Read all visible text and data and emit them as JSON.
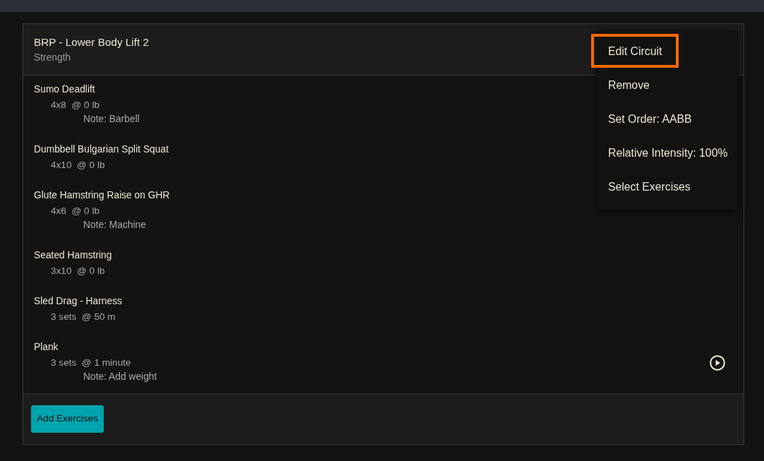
{
  "circuit": {
    "title": "BRP - Lower Body Lift 2",
    "category": "Strength"
  },
  "exercises": [
    {
      "name": "Sumo Deadlift",
      "prescription": "4x8  @ 0 lb",
      "note": "Note: Barbell",
      "video": false
    },
    {
      "name": "Dumbbell Bulgarian Split Squat",
      "prescription": "4x10  @ 0 lb",
      "video": false
    },
    {
      "name": "Glute Hamstring Raise on GHR",
      "prescription": "4x6  @ 0 lb",
      "note": "Note: Machine",
      "video": false
    },
    {
      "name": "Seated Hamstring",
      "prescription": "3x10  @ 0 lb",
      "video": false
    },
    {
      "name": "Sled Drag - Harness",
      "prescription": "3 sets  @ 50 m",
      "video": false
    },
    {
      "name": "Plank",
      "prescription": "3 sets  @ 1 minute",
      "note": "Note: Add weight",
      "video": true
    }
  ],
  "footer": {
    "button": "Add Exercises"
  },
  "menu": {
    "items": [
      {
        "label": "Edit Circuit",
        "highlighted": true
      },
      {
        "label": "Remove",
        "highlighted": false
      },
      {
        "label": "Set Order: AABB",
        "highlighted": false
      },
      {
        "label": "Relative Intensity: 100%",
        "highlighted": false
      },
      {
        "label": "Select Exercises",
        "highlighted": false
      }
    ]
  }
}
